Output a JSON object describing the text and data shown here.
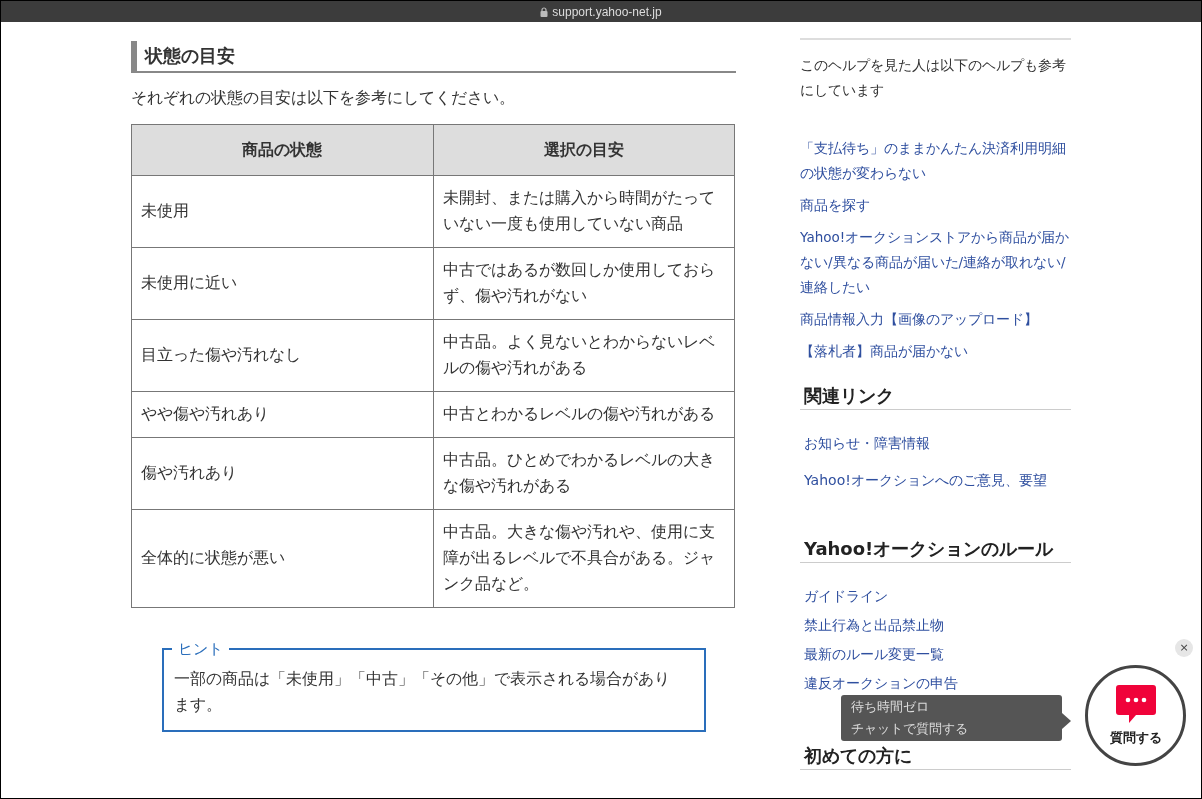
{
  "browser": {
    "url": "support.yahoo-net.jp"
  },
  "section": {
    "title": "状態の目安",
    "intro": "それぞれの状態の目安は以下を参考にしてください。",
    "table": {
      "columns": [
        "商品の状態",
        "選択の目安"
      ],
      "rows": [
        [
          "未使用",
          "未開封、または購入から時間がたっていない一度も使用していない商品"
        ],
        [
          "未使用に近い",
          "中古ではあるが数回しか使用しておらず、傷や汚れがない"
        ],
        [
          "目立った傷や汚れなし",
          "中古品。よく見ないとわからないレベルの傷や汚れがある"
        ],
        [
          "やや傷や汚れあり",
          "中古とわかるレベルの傷や汚れがある"
        ],
        [
          "傷や汚れあり",
          "中古品。ひとめでわかるレベルの大きな傷や汚れがある"
        ],
        [
          "全体的に状態が悪い",
          "中古品。大きな傷や汚れや、使用に支障が出るレベルで不具合がある。ジャンク品など。"
        ]
      ]
    },
    "hint": {
      "label": "ヒント",
      "text": "一部の商品は「未使用」「中古」「その他」で表示される場合があります。"
    }
  },
  "sidebar": {
    "related_help": {
      "title": "このヘルプを見た人は以下のヘルプも参考にしています",
      "links": [
        "「支払待ち」のままかんたん決済利用明細の状態が変わらない",
        "商品を探す",
        "Yahoo!オークションストアから商品が届かない/異なる商品が届いた/連絡が取れない/連絡したい",
        "商品情報入力【画像のアップロード】",
        "【落札者】商品が届かない"
      ]
    },
    "sections": [
      {
        "title": "関連リンク",
        "links": [
          "お知らせ・障害情報",
          "Yahoo!オークションへのご意見、要望"
        ]
      },
      {
        "title": "Yahoo!オークションのルール",
        "links": [
          "ガイドライン",
          "禁止行為と出品禁止物",
          "最新のルール変更一覧",
          "違反オークションの申告"
        ]
      },
      {
        "title": "初めての方に"
      }
    ]
  },
  "chat_widget": {
    "tooltip": [
      "待ち時間ゼロ",
      "チャットで質問する"
    ],
    "button": "質問する",
    "close": "×"
  }
}
